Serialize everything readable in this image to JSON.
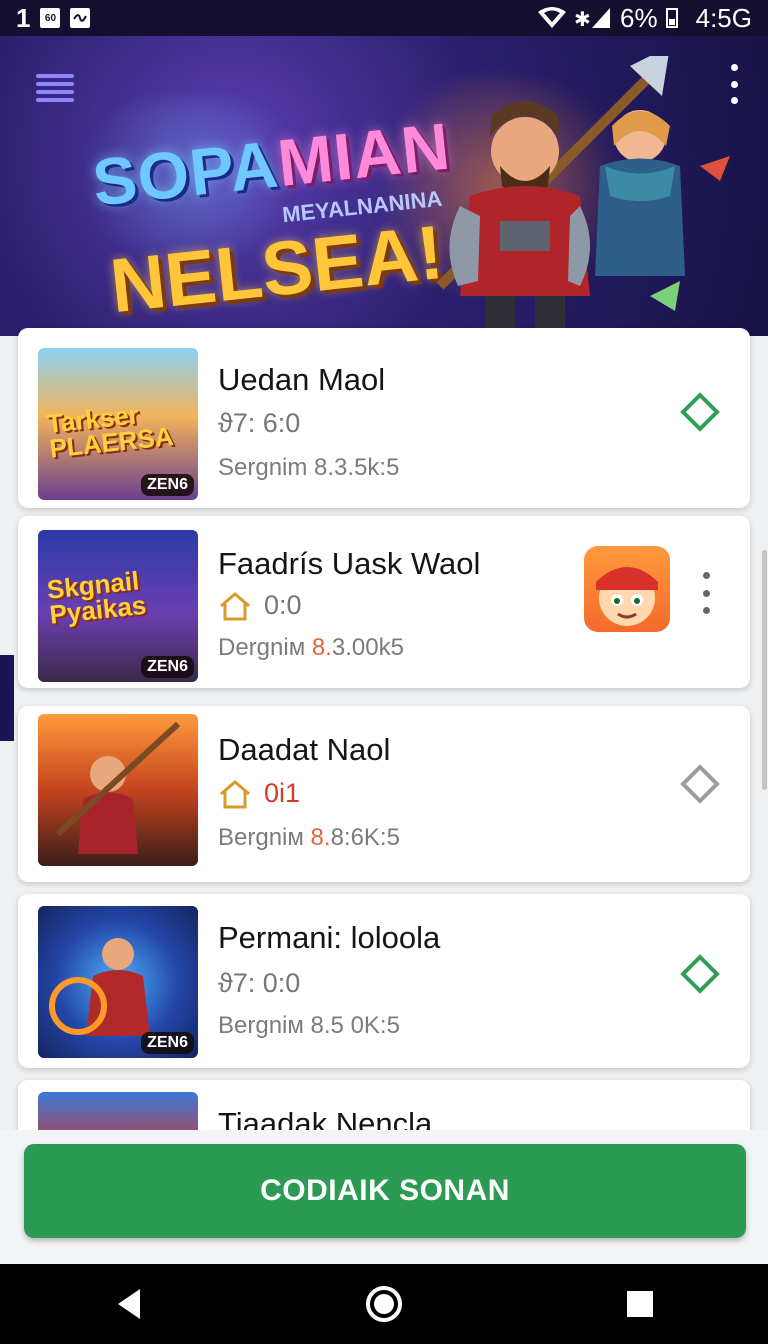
{
  "status_bar": {
    "left_number": "1",
    "left_box_text": "60",
    "battery": "6%",
    "time": "4:5G"
  },
  "hero": {
    "title_part1": "SOPA",
    "title_part2": "MIAN",
    "subtitle": "MEYALNANINA",
    "big_title": "NELSEA!"
  },
  "cards": [
    {
      "title": "Uedan Maol",
      "meta": "ϑ7: 6:0",
      "sub": "Sergnim 8.3.5k:5",
      "thumb_label": "Tarkser PLAERSA",
      "badge": "ZEN6"
    },
    {
      "title": "Faadrís Uask Waol",
      "meta": "0:0",
      "sub_a": "Dergniм ",
      "sub_hl": "8.",
      "sub_b": "3.00k5",
      "thumb_label": "Skgnail Pyaikas",
      "badge": "ZEN6"
    },
    {
      "title": "Daadat Naol",
      "meta": "0i1",
      "sub_a": "Bergniм ",
      "sub_hl": "8.",
      "sub_b": "8:6K:5"
    },
    {
      "title": "Permani: loloola",
      "meta": "ϑ7: 0:0",
      "sub": "Bergniм 8.5 0K:5",
      "badge": "ZEN6"
    },
    {
      "title": "Tiaadak Nencla"
    }
  ],
  "action_button": "CODIAIK SONAN",
  "colors": {
    "accent_green": "#2b9a53",
    "diamond_green": "#2e9f55",
    "header_bg": "#171244"
  },
  "icons": {
    "menu": "hamburger-icon",
    "more": "more-vertical-icon",
    "home": "home-outline-icon",
    "back": "back-triangle-icon",
    "home_nav": "home-circle-icon",
    "recents": "recents-square-icon"
  }
}
